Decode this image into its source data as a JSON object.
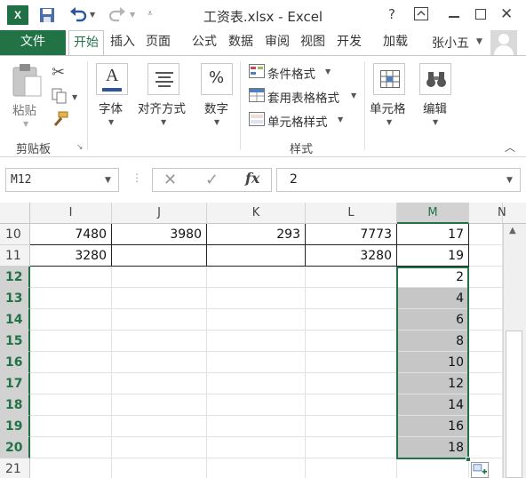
{
  "window": {
    "title": "工资表.xlsx - Excel",
    "app_logo": "X",
    "icons": [
      "excel-logo-icon",
      "save-icon",
      "undo-icon",
      "redo-icon",
      "help-icon",
      "ribbon-display-icon",
      "minimize-icon",
      "maximize-icon",
      "close-icon"
    ],
    "help": "?",
    "close": "✕"
  },
  "tabs": [
    {
      "label": "文件"
    },
    {
      "label": "开始"
    },
    {
      "label": "插入"
    },
    {
      "label": "页面"
    },
    {
      "label": "公式"
    },
    {
      "label": "数据"
    },
    {
      "label": "审阅"
    },
    {
      "label": "视图"
    },
    {
      "label": "开发"
    },
    {
      "label": "加载"
    }
  ],
  "user": {
    "name": "张小五"
  },
  "ribbon": {
    "clipboard": {
      "paste": "粘贴",
      "group": "剪贴板"
    },
    "font": {
      "label": "字体",
      "glyph": "A"
    },
    "alignment": {
      "label": "对齐方式"
    },
    "number": {
      "label": "数字",
      "glyph": "%"
    },
    "styles": {
      "conditional": "条件格式",
      "table": "套用表格格式",
      "cell_styles": "单元格样式",
      "group": "样式"
    },
    "cells": {
      "label": "单元格"
    },
    "editing": {
      "label": "编辑"
    }
  },
  "formula_bar": {
    "name_box": "M12",
    "fx": "fx",
    "cancel": "✕",
    "enter": "✓",
    "value": "2"
  },
  "grid": {
    "columns": [
      "I",
      "J",
      "K",
      "L",
      "M"
    ],
    "partial_column": "N",
    "selected_column": "M",
    "rows": [
      {
        "n": "10",
        "I": "7480",
        "J": "3980",
        "K": "293",
        "L": "7773",
        "M": "17"
      },
      {
        "n": "11",
        "I": "3280",
        "J": "",
        "K": "",
        "L": "3280",
        "M": "19"
      },
      {
        "n": "12",
        "M": "2"
      },
      {
        "n": "13",
        "M": "4"
      },
      {
        "n": "14",
        "M": "6"
      },
      {
        "n": "15",
        "M": "8"
      },
      {
        "n": "16",
        "M": "10"
      },
      {
        "n": "17",
        "M": "12"
      },
      {
        "n": "18",
        "M": "14"
      },
      {
        "n": "19",
        "M": "16"
      },
      {
        "n": "20",
        "M": "18"
      },
      {
        "n": "21",
        "M": ""
      }
    ]
  },
  "colors": {
    "accent": "#217346",
    "selection_fill": "#c6c6c6"
  }
}
